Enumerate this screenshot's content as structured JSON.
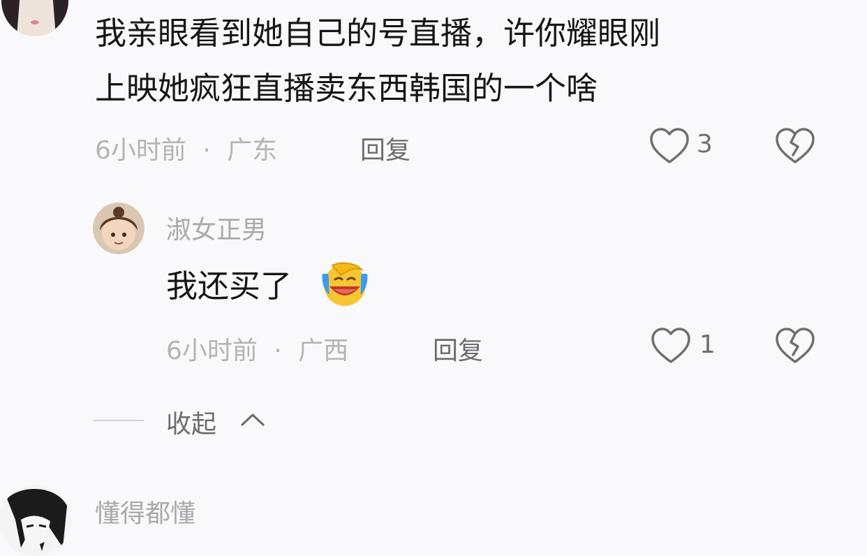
{
  "top_comment": {
    "line1": "我亲眼看到她自己的号直播，许你耀眼刚",
    "line2": "上映她疯狂直播卖东西韩国的一个啥",
    "time": "6小时前",
    "dot": "·",
    "location": "广东",
    "reply_label": "回复",
    "likes": "3"
  },
  "reply": {
    "username": "淑女正男",
    "text": "我还买了",
    "emoji": "crying-laughing-emoji",
    "time": "6小时前",
    "dot": "·",
    "location": "广西",
    "reply_label": "回复",
    "likes": "1"
  },
  "collapse": {
    "label": "收起"
  },
  "next_comment": {
    "username": "懂得都懂"
  },
  "colors": {
    "text": "#161616",
    "meta": "#b3b3b8",
    "icon": "#6e6e73",
    "background": "#f9f9fb"
  }
}
